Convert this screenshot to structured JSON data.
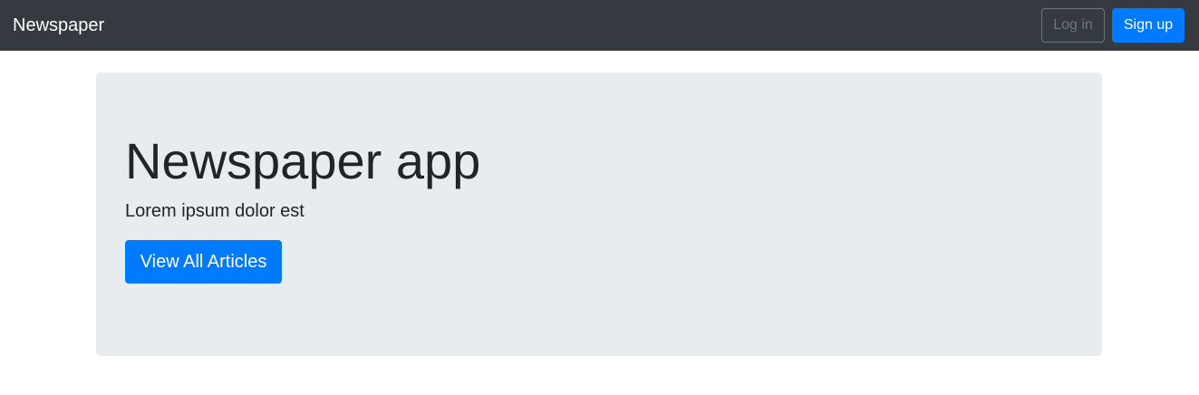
{
  "navbar": {
    "brand": "Newspaper",
    "login_label": "Log in",
    "signup_label": "Sign up"
  },
  "hero": {
    "title": "Newspaper app",
    "text": "Lorem ipsum dolor est",
    "button_label": "View All Articles"
  },
  "colors": {
    "navbar_bg": "#343a40",
    "primary": "#007bff",
    "jumbotron_bg": "#e9ecef"
  }
}
